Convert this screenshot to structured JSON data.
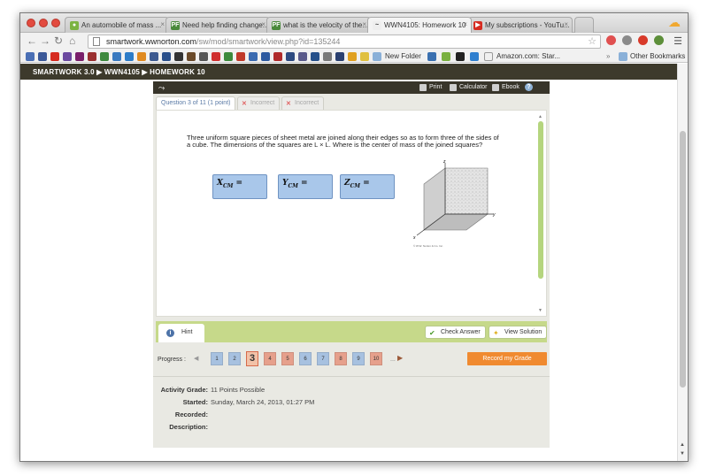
{
  "browser": {
    "tabs": [
      {
        "label": "An automobile of mass ...",
        "favicon": "cheggs",
        "color": "#7cb342"
      },
      {
        "label": "Need help finding change...",
        "favicon": "PF",
        "color": "#4a8a3c"
      },
      {
        "label": "what is the velocity of the...",
        "favicon": "PF",
        "color": "#4a8a3c"
      },
      {
        "label": "WWN4105: Homework 10",
        "favicon": "swoosh",
        "color": "#555555"
      },
      {
        "label": "My subscriptions - YouTu...",
        "favicon": "YT",
        "color": "#d62b20"
      }
    ],
    "url_host": "smartwork.wwnorton.com",
    "url_path": "/sw/mod/smartwork/view.php?id=135244",
    "bookmark_labels": {
      "new_folder": "New Folder",
      "amazon": "Amazon.com: Star...",
      "other": "Other Bookmarks"
    }
  },
  "breadcrumb": "SMARTWORK 3.0 ▶ WWN4105 ▶ HOMEWORK 10",
  "topbar": {
    "print": "Print",
    "calculator": "Calculator",
    "ebook": "Ebook",
    "help": "?"
  },
  "question_tabs": {
    "current": "Question 3 of 11 (1 point)",
    "attempts": [
      "Incorrect",
      "Incorrect"
    ]
  },
  "question": {
    "text": "Three uniform square pieces of sheet metal are joined along their edges so as to form three of the sides of a cube. The dimensions of the squares are L × L. Where is the center of mass of the joined squares?",
    "answers": [
      {
        "var": "X",
        "sub": "CM",
        "eq": "="
      },
      {
        "var": "Y",
        "sub": "CM",
        "eq": "="
      },
      {
        "var": "Z",
        "sub": "CM",
        "eq": "="
      }
    ],
    "figure_axes": {
      "z": "z",
      "y": "y",
      "x": "x"
    },
    "figure_caption": "© W.W. Norton & Co. Inc."
  },
  "actions": {
    "hint": "Hint",
    "check_answer": "Check Answer",
    "view_solution": "View Solution"
  },
  "progress": {
    "label": "Progress :",
    "items": [
      {
        "n": "1",
        "state": "blue"
      },
      {
        "n": "2",
        "state": "blue"
      },
      {
        "n": "3",
        "state": "current"
      },
      {
        "n": "4",
        "state": "red"
      },
      {
        "n": "5",
        "state": "red"
      },
      {
        "n": "6",
        "state": "blue"
      },
      {
        "n": "7",
        "state": "blue"
      },
      {
        "n": "8",
        "state": "red"
      },
      {
        "n": "9",
        "state": "blue"
      },
      {
        "n": "10",
        "state": "red"
      }
    ],
    "ellipsis": "...",
    "record_label": "Record my Grade"
  },
  "info": [
    {
      "label": "Activity Grade:",
      "value": "11 Points Possible"
    },
    {
      "label": "Started:",
      "value": "Sunday, March 24, 2013, 01:27 PM"
    },
    {
      "label": "Recorded:",
      "value": ""
    },
    {
      "label": "Description:",
      "value": ""
    }
  ]
}
